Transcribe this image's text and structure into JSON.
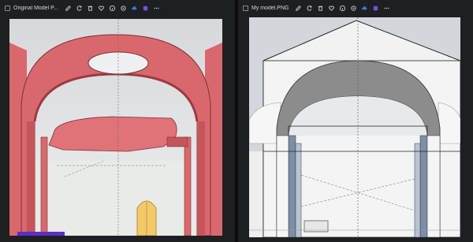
{
  "windows": [
    {
      "title": "Original Model P...",
      "toolbar": [
        "edit-icon",
        "rotate-icon",
        "delete-icon",
        "heart-icon",
        "info-icon",
        "crop-icon",
        "cloud-icon",
        "app-icon",
        "more-icon"
      ]
    },
    {
      "title": "My model.PNG",
      "toolbar": [
        "edit-icon",
        "rotate-icon",
        "delete-icon",
        "heart-icon",
        "info-icon",
        "crop-icon",
        "cloud-icon",
        "app-icon",
        "more-icon"
      ]
    }
  ],
  "colors": {
    "window_bg": "#1e1f22",
    "arch_red": "#d9686d",
    "door_yellow": "#f3c969",
    "arch_grey": "#8c8c8c",
    "accent_blue": "#2f7bd8",
    "accent_purple": "#7a4ee0"
  }
}
